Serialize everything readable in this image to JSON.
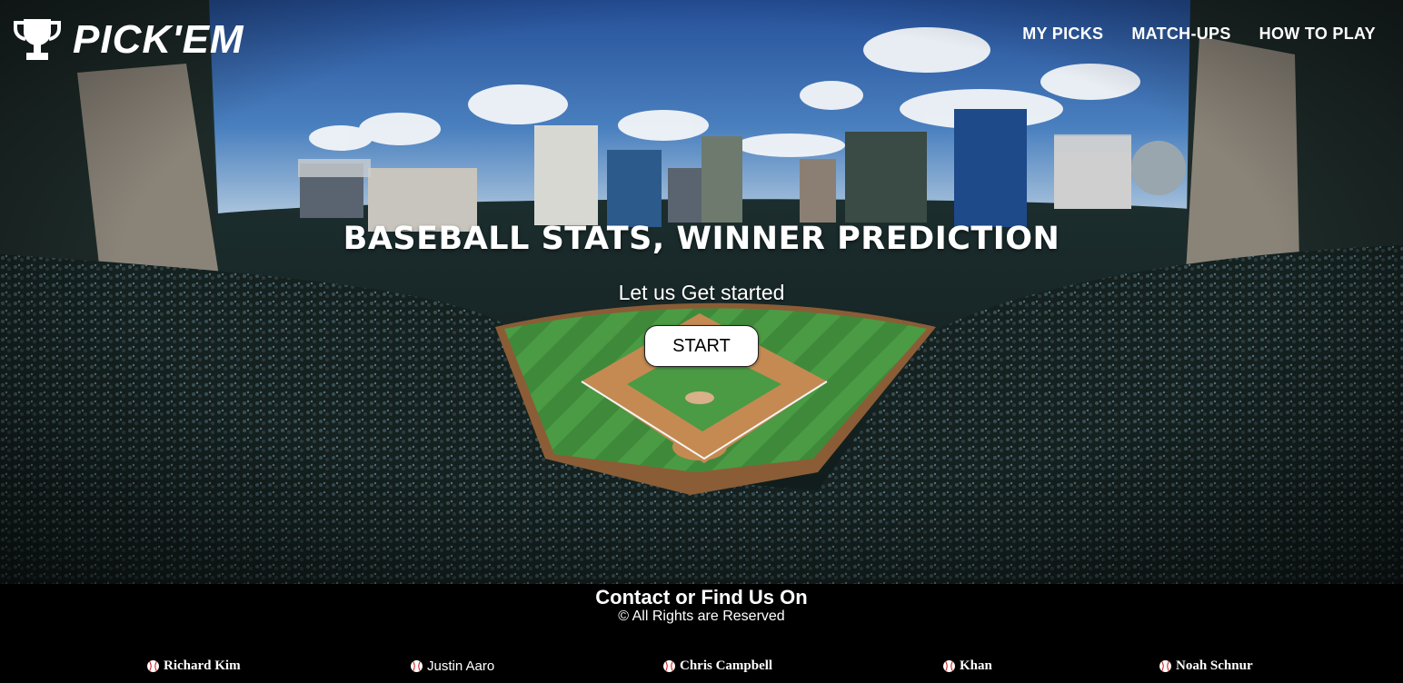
{
  "header": {
    "brand": "PICK'EM",
    "logo_icon": "trophy-icon",
    "nav": [
      {
        "label": "MY PICKS"
      },
      {
        "label": "MATCH-UPS"
      },
      {
        "label": "HOW TO PLAY"
      }
    ]
  },
  "hero": {
    "headline": "BASEBALL STATS, WINNER PREDICTION",
    "tagline": "Let us Get started",
    "start_label": "START"
  },
  "footer": {
    "title": "Contact or Find Us On",
    "rights": "© All Rights are Reserved",
    "team": [
      {
        "name": "Richard Kim",
        "icon": "baseball-icon"
      },
      {
        "name": "Justin Aaro",
        "icon": "baseball-icon"
      },
      {
        "name": "Chris Campbell",
        "icon": "baseball-icon"
      },
      {
        "name": "Khan",
        "icon": "baseball-icon"
      },
      {
        "name": "Noah Schnur",
        "icon": "baseball-icon"
      }
    ]
  },
  "colors": {
    "sky": "#3e6fb0",
    "grass": "#3f8a3a",
    "dirt": "#b07a46",
    "stands": "#1a2b2a",
    "footer_bg": "#000000",
    "text": "#ffffff"
  }
}
